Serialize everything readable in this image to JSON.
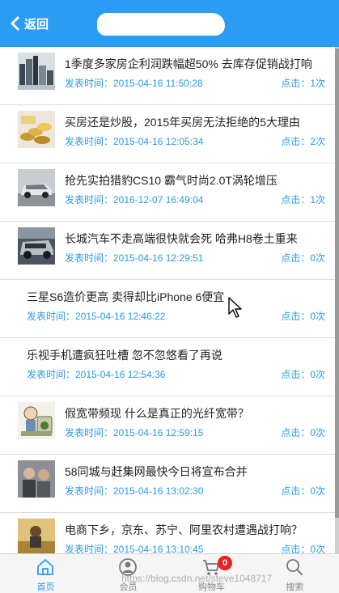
{
  "header": {
    "back_label": "返回",
    "accent_color": "#2b9cf3"
  },
  "articles": [
    {
      "title": "1季度多家房企利润跌幅超50% 去库存促销战打响",
      "time": "发表时间：2015-04-16 11:50:28",
      "clicks": "点击：1次",
      "image": "buildings-thumbnail"
    },
    {
      "title": "买房还是炒股，2015年买房无法拒绝的5大理由",
      "time": "发表时间：2015-04-16 12:05:34",
      "clicks": "点击：2次",
      "image": "coins-thumbnail"
    },
    {
      "title": "抢先实拍猎豹CS10 霸气时尚2.0T涡轮增压",
      "time": "发表时间：2016-12-07 16:49:04",
      "clicks": "点击：1次",
      "image": "suv-thumbnail"
    },
    {
      "title": "长城汽车不走高端很快就会死 哈弗H8卷土重来",
      "time": "发表时间：2015-04-16 12:29:51",
      "clicks": "点击：0次",
      "image": "car-thumbnail"
    },
    {
      "title": "三星S6造价更高 卖得却比iPhone 6便宜",
      "time": "发表时间：2015-04-16 12:46:22",
      "clicks": "点击：0次",
      "image": null
    },
    {
      "title": "乐视手机遭疯狂吐槽 忽不忽悠看了再说",
      "time": "发表时间：2015-04-16 12:54:36",
      "clicks": "点击：0次",
      "image": null
    },
    {
      "title": "假宽带频现 什么是真正的光纤宽带？",
      "time": "发表时间：2015-04-16 12:59:15",
      "clicks": "点击：0次",
      "image": "cartoon-money-thumbnail"
    },
    {
      "title": "58同城与赶集网最快今日将宣布合并",
      "time": "发表时间：2015-04-16 13:02:30",
      "clicks": "点击：0次",
      "image": "people-thumbnail"
    },
    {
      "title": "电商下乡，京东、苏宁、阿里农村遭遇战打响？",
      "time": "发表时间：2015-04-16 13:10:45",
      "clicks": "点击：0次",
      "image": "farmer-thumbnail"
    }
  ],
  "nav": {
    "home": "首页",
    "member": "会员",
    "cart": "购物车",
    "search": "搜索",
    "cart_badge": "0"
  },
  "watermark": "https://blog.csdn.net/steve1048717"
}
